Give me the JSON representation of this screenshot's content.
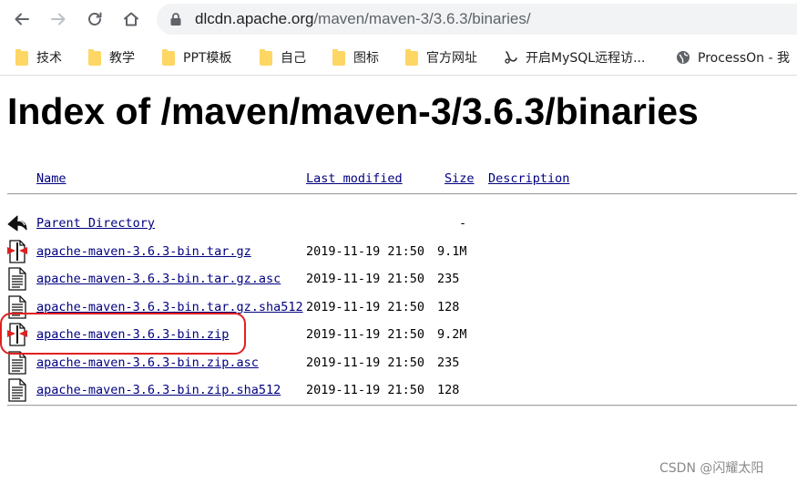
{
  "browser": {
    "url_host": "dlcdn.apache.org",
    "url_path": "/maven/maven-3/3.6.3/binaries/"
  },
  "bookmarks": [
    {
      "label": "技术",
      "icon": "folder-icon"
    },
    {
      "label": "教学",
      "icon": "folder-icon"
    },
    {
      "label": "PPT模板",
      "icon": "folder-icon"
    },
    {
      "label": "自己",
      "icon": "folder-icon"
    },
    {
      "label": "图标",
      "icon": "folder-icon"
    },
    {
      "label": "官方网址",
      "icon": "folder-icon"
    },
    {
      "label": "开启MySQL远程访...",
      "icon": "site-favicon-icon"
    },
    {
      "label": "ProcessOn - 我",
      "icon": "globe-icon"
    }
  ],
  "page": {
    "title": "Index of /maven/maven-3/3.6.3/binaries"
  },
  "listing": {
    "columns": {
      "name": "Name",
      "last_modified": "Last modified",
      "size": "Size",
      "description": "Description"
    },
    "rows": [
      {
        "name": "Parent Directory",
        "date": "",
        "size": "-",
        "icon": "back-arrow-icon"
      },
      {
        "name": "apache-maven-3.6.3-bin.tar.gz",
        "date": "2019-11-19 21:50",
        "size": "9.1M",
        "icon": "archive-icon"
      },
      {
        "name": "apache-maven-3.6.3-bin.tar.gz.asc",
        "date": "2019-11-19 21:50",
        "size": "235",
        "icon": "text-file-icon"
      },
      {
        "name": "apache-maven-3.6.3-bin.tar.gz.sha512",
        "date": "2019-11-19 21:50",
        "size": "128",
        "icon": "text-file-icon"
      },
      {
        "name": "apache-maven-3.6.3-bin.zip",
        "date": "2019-11-19 21:50",
        "size": "9.2M",
        "icon": "archive-icon"
      },
      {
        "name": "apache-maven-3.6.3-bin.zip.asc",
        "date": "2019-11-19 21:50",
        "size": "235",
        "icon": "text-file-icon"
      },
      {
        "name": "apache-maven-3.6.3-bin.zip.sha512",
        "date": "2019-11-19 21:50",
        "size": "128",
        "icon": "text-file-icon"
      }
    ]
  },
  "watermark": "CSDN @闪耀太阳",
  "colors": {
    "link": "#000080",
    "highlight": "#e02020",
    "folder": "#fdd663"
  }
}
